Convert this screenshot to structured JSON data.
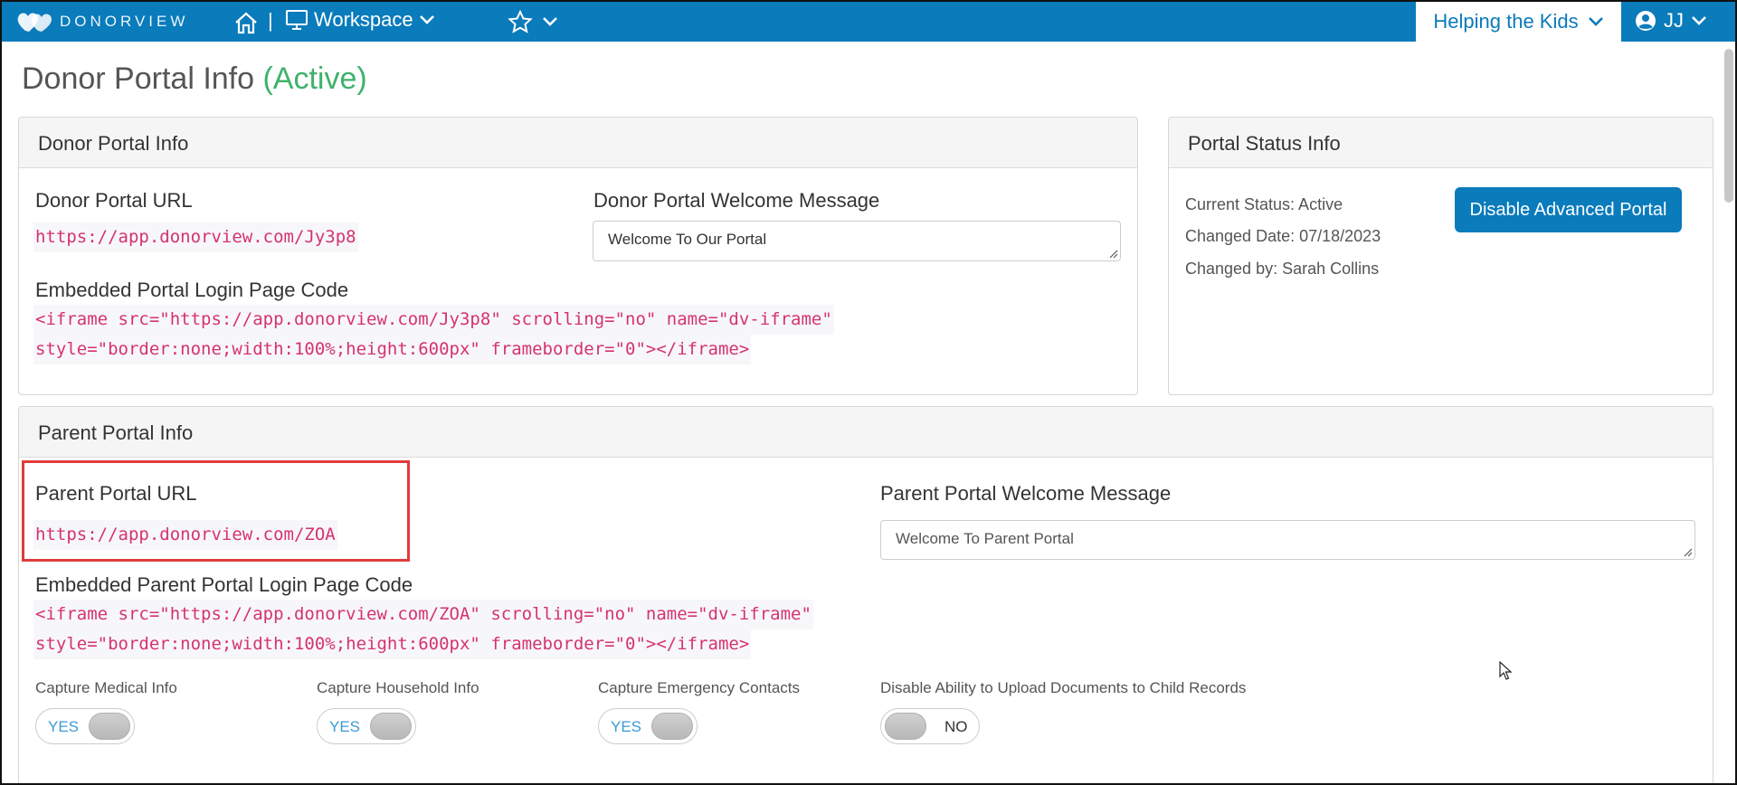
{
  "app": {
    "logo_text": "DONORVIEW",
    "workspace_label": "Workspace",
    "org_name": "Helping the Kids",
    "user_initials": "JJ",
    "separator": "|"
  },
  "page": {
    "title": "Donor Portal Info",
    "status": "(Active)",
    "status_color": "#3fb26b"
  },
  "donor_panel": {
    "heading": "Donor Portal Info",
    "url_label": "Donor Portal URL",
    "url_value": "https://app.donorview.com/Jy3p8",
    "welcome_label": "Donor Portal Welcome Message",
    "welcome_value": "Welcome To Our Portal",
    "embed_label": "Embedded Portal Login Page Code",
    "embed_line1": "<iframe src=\"https://app.donorview.com/Jy3p8\" scrolling=\"no\" name=\"dv-iframe\"",
    "embed_line2": "style=\"border:none;width:100%;height:600px\" frameborder=\"0\"></iframe>"
  },
  "status_panel": {
    "heading": "Portal Status Info",
    "current_status": "Current Status: Active",
    "changed_date": "Changed Date: 07/18/2023",
    "changed_by": "Changed by: Sarah Collins",
    "disable_button": "Disable Advanced Portal"
  },
  "parent_panel": {
    "heading": "Parent Portal Info",
    "url_label": "Parent Portal URL",
    "url_value": "https://app.donorview.com/ZOA",
    "welcome_label": "Parent Portal Welcome Message",
    "welcome_value": "Welcome To Parent Portal",
    "embed_label": "Embedded Parent Portal Login Page Code",
    "embed_line1": "<iframe src=\"https://app.donorview.com/ZOA\" scrolling=\"no\" name=\"dv-iframe\"",
    "embed_line2": "style=\"border:none;width:100%;height:600px\" frameborder=\"0\"></iframe>",
    "toggles": [
      {
        "label": "Capture Medical Info",
        "state": "YES"
      },
      {
        "label": "Capture Household Info",
        "state": "YES"
      },
      {
        "label": "Capture Emergency Contacts",
        "state": "YES"
      },
      {
        "label": "Disable Ability to Upload Documents to Child Records",
        "state": "NO"
      }
    ]
  },
  "colors": {
    "brand": "#0a7bbb",
    "code_text": "#d6336c",
    "highlight": "#e03c3c",
    "toggle_on_text": "#3a9ad9"
  }
}
